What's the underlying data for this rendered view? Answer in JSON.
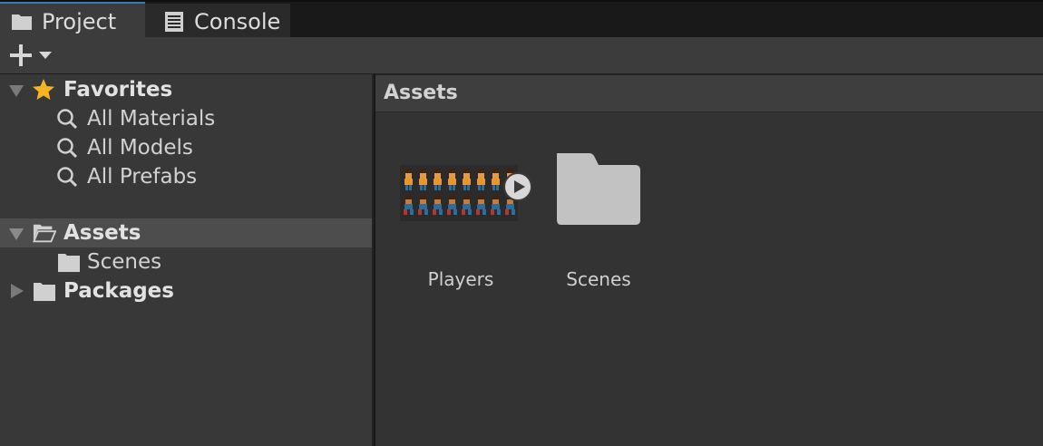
{
  "tabs": [
    {
      "label": "Project",
      "icon": "folder-icon",
      "active": true
    },
    {
      "label": "Console",
      "icon": "console-icon",
      "active": false
    }
  ],
  "toolbar": {
    "add_icon": "plus-icon",
    "dropdown_icon": "caret-down-icon"
  },
  "tree": {
    "favorites": {
      "label": "Favorites",
      "icon": "star-icon",
      "items": [
        {
          "label": "All Materials",
          "icon": "search-icon"
        },
        {
          "label": "All Models",
          "icon": "search-icon"
        },
        {
          "label": "All Prefabs",
          "icon": "search-icon"
        }
      ]
    },
    "assets": {
      "label": "Assets",
      "icon": "folder-open-icon",
      "children": [
        {
          "label": "Scenes",
          "icon": "folder-icon"
        }
      ]
    },
    "packages": {
      "label": "Packages",
      "icon": "folder-icon"
    }
  },
  "content": {
    "breadcrumb": "Assets",
    "items": [
      {
        "label": "Players",
        "type": "sprite-sheet",
        "icon": "play-icon"
      },
      {
        "label": "Scenes",
        "type": "folder",
        "icon": "folder-icon"
      }
    ]
  },
  "colors": {
    "accent": "#3a79bb",
    "folder": "#c2c2c2",
    "star": "#f4b521"
  }
}
